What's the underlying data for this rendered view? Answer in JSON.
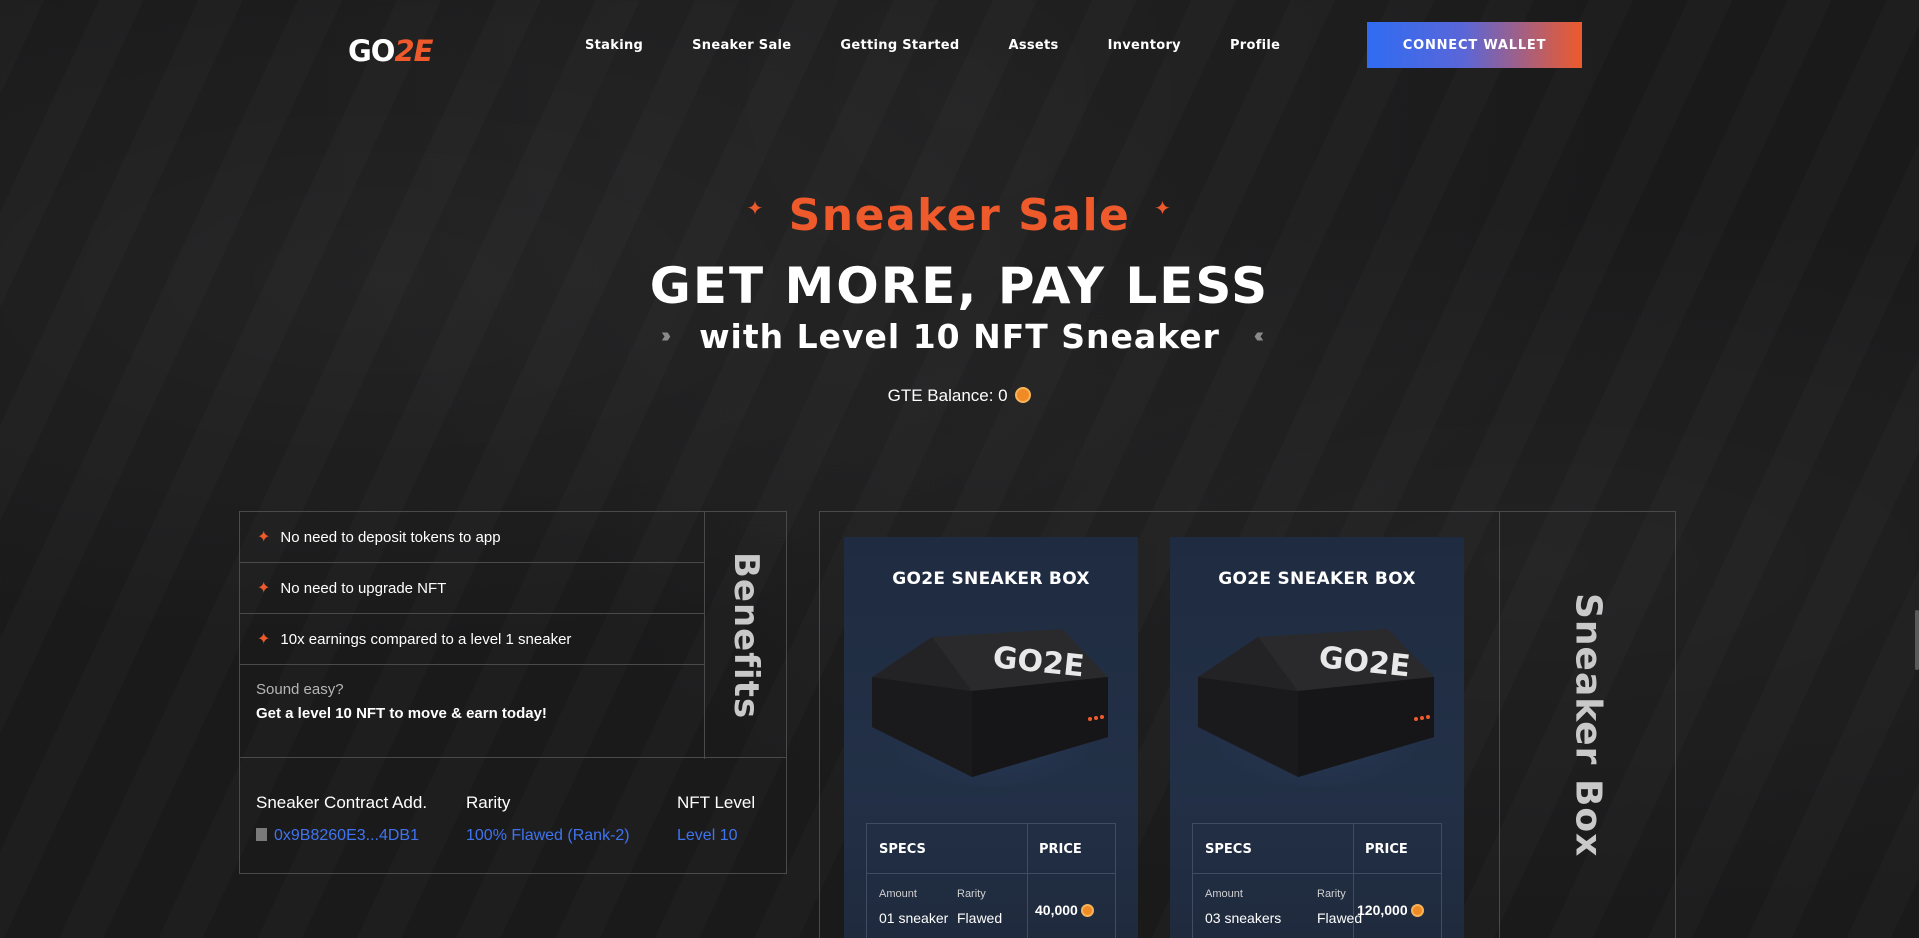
{
  "nav": {
    "logo_part1": "GO",
    "logo_part2": "2E",
    "items": [
      "Staking",
      "Sneaker Sale",
      "Getting Started",
      "Assets",
      "Inventory",
      "Profile"
    ],
    "connect_label": "CONNECT WALLET"
  },
  "hero": {
    "title": "Sneaker Sale",
    "headline": "GET MORE, PAY LESS",
    "subline": "with Level 10 NFT Sneaker",
    "balance_label": "GTE Balance: 0"
  },
  "benefits": {
    "items": [
      "No need to deposit tokens to app",
      "No need to upgrade NFT",
      "10x earnings compared to a level 1 sneaker"
    ],
    "question": "Sound easy?",
    "cta": "Get a level 10 NFT to move & earn today!",
    "label": "Benefits"
  },
  "contract": {
    "address_header": "Sneaker Contract Add.",
    "address_value": "0x9B8260E3...4DB1",
    "rarity_header": "Rarity",
    "rarity_value": "100% Flawed (Rank-2)",
    "level_header": "NFT Level",
    "level_value": "Level 10"
  },
  "boxes": {
    "label": "Sneaker Box",
    "cards": [
      {
        "title": "GO2E SNEAKER BOX",
        "box_brand": "GO2E",
        "specs_header": "SPECS",
        "price_header": "PRICE",
        "amount_label": "Amount",
        "amount_value": "01 sneaker",
        "rarity_label": "Rarity",
        "rarity_value": "Flawed",
        "price": "40,000"
      },
      {
        "title": "GO2E SNEAKER BOX",
        "box_brand": "GO2E",
        "specs_header": "SPECS",
        "price_header": "PRICE",
        "amount_label": "Amount",
        "amount_value": "03 sneakers",
        "rarity_label": "Rarity",
        "rarity_value": "Flawed",
        "price": "120,000"
      }
    ]
  },
  "colors": {
    "accent": "#ee5a2b",
    "link": "#3f74f0",
    "background": "#1b1b1c",
    "card": "#223047"
  }
}
